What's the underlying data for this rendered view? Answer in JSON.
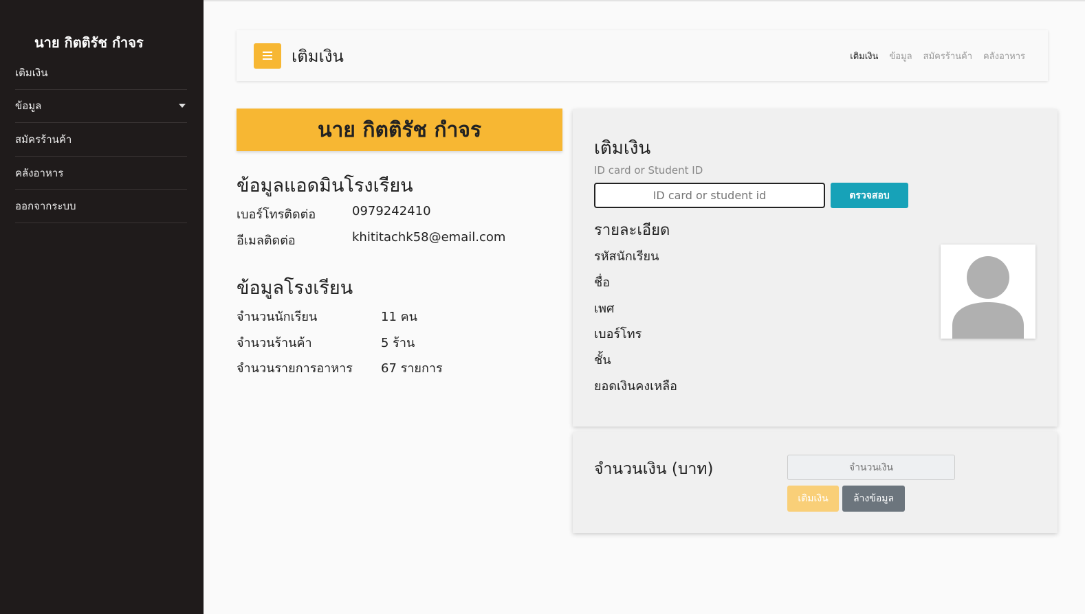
{
  "sidebar": {
    "user_name": "นาย กิตติรัช กำจร",
    "items": [
      {
        "label": "เติมเงิน"
      },
      {
        "label": "ข้อมูล"
      },
      {
        "label": "สมัครร้านค้า"
      },
      {
        "label": "คลังอาหาร"
      },
      {
        "label": "ออกจากระบบ"
      }
    ]
  },
  "topbar": {
    "title": "เติมเงิน",
    "nav": [
      "เติมเงิน",
      "ข้อมูล",
      "สมัครร้านค้า",
      "คลังอาหาร"
    ]
  },
  "profile": {
    "name_banner": "นาย กิตติรัช กำจร",
    "admin_heading": "ข้อมูลแอดมินโรงเรียน",
    "phone_label": "เบอร์โทรติดต่อ",
    "phone_value": "0979242410",
    "email_label": "อีเมลติดต่อ",
    "email_value": "khititachk58@email.com",
    "school_heading": "ข้อมูลโรงเรียน",
    "students_label": "จำนวนนักเรียน",
    "students_value": "11 คน",
    "shops_label": "จำนวนร้านค้า",
    "shops_value": "5 ร้าน",
    "menu_label": "จำนวนรายการอาหาร",
    "menu_value": "67 รายการ"
  },
  "topup": {
    "title": "เติมเงิน",
    "id_label": "ID card or Student ID",
    "id_placeholder": "ID card or student id",
    "check_button": "ตรวจสอบ",
    "details_heading": "รายละเอียด",
    "fields": [
      "รหัสนักเรียน",
      "ชื่อ",
      "เพศ",
      "เบอร์โทร",
      "ชั้น",
      "ยอดเงินคงเหลือ"
    ]
  },
  "amount": {
    "label": "จำนวนเงิน (บาท)",
    "placeholder": "จำนวนเงิน",
    "topup_button": "เติมเงิน",
    "clear_button": "ล้างข้อมูล"
  },
  "colors": {
    "accent": "#f7b733",
    "sidebar_bg": "#1f1b1b",
    "info_button": "#17a2b8",
    "secondary_button": "#6c757d"
  }
}
